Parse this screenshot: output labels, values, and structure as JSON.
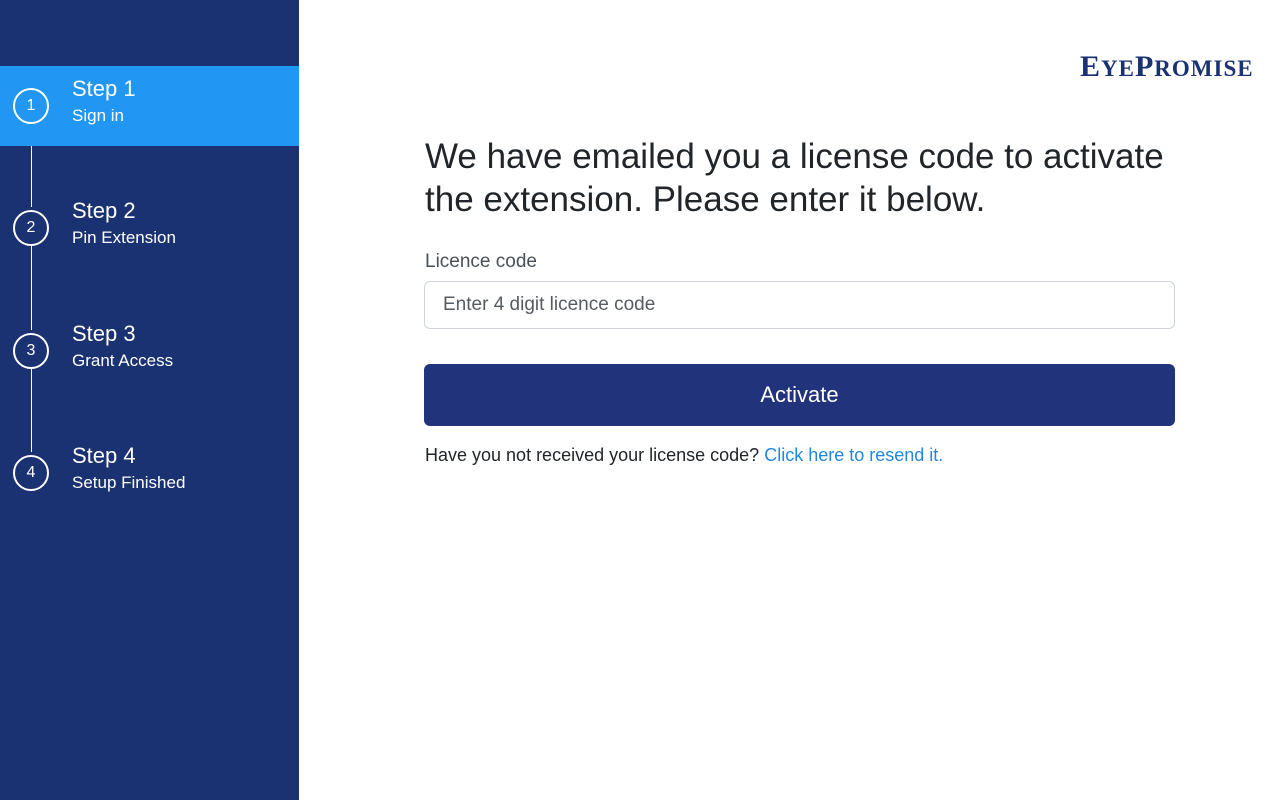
{
  "sidebar": {
    "steps": [
      {
        "number": "1",
        "title": "Step 1",
        "subtitle": "Sign in",
        "active": true
      },
      {
        "number": "2",
        "title": "Step 2",
        "subtitle": "Pin Extension",
        "active": false
      },
      {
        "number": "3",
        "title": "Step 3",
        "subtitle": "Grant Access",
        "active": false
      },
      {
        "number": "4",
        "title": "Step 4",
        "subtitle": "Setup Finished",
        "active": false
      }
    ]
  },
  "brand": {
    "logo_first_e": "E",
    "logo_ye": "YE",
    "logo_p": "P",
    "logo_romise": "ROMISE"
  },
  "main": {
    "message": "We have emailed you a license code to activate the extension. Please enter it below.",
    "field_label": "Licence code",
    "input_value": "",
    "input_placeholder": "Enter 4 digit licence code",
    "activate_label": "Activate",
    "resend_prompt": "Have you not received your license code?",
    "resend_link": "Click here to resend it."
  },
  "colors": {
    "sidebar_bg": "#1a3172",
    "active_step_bg": "#2196f3",
    "button_bg": "#21337a",
    "link": "#1e88e5"
  }
}
